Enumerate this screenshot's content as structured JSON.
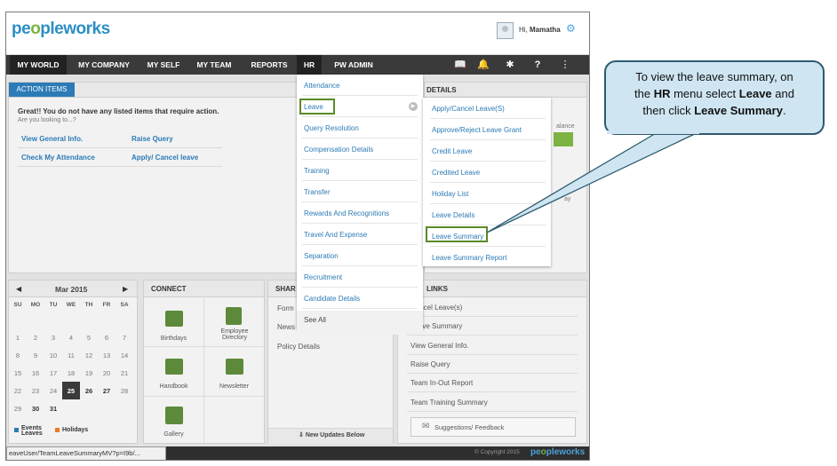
{
  "brand": {
    "logo_a": "pe",
    "logo_o1": "o",
    "logo_b": "pleworks",
    "logo_c": "w",
    "logo_o2": "o",
    "logo_d": "rks"
  },
  "user": {
    "greeting": "Hi,",
    "name": "Mamatha"
  },
  "nav": {
    "items": [
      "MY WORLD",
      "MY COMPANY",
      "MY SELF",
      "MY TEAM",
      "REPORTS",
      "HR",
      "PW ADMIN"
    ],
    "icons": [
      "book-icon",
      "bell-icon",
      "tools-icon",
      "help-icon",
      "menu-icon"
    ]
  },
  "action_items": {
    "tab": "ACTION ITEMS",
    "heading": "Great!! You do not have any listed items that require action.",
    "sub": "Are you looking to...?",
    "links": [
      "View General Info.",
      "Raise Query",
      "Check My Attendance",
      "Apply/ Cancel leave"
    ]
  },
  "details_panel": {
    "title": "DETAILS",
    "text1": "alance",
    "text2": "ay"
  },
  "calendar": {
    "month": "Mar 2015",
    "days": [
      "SU",
      "MO",
      "TU",
      "WE",
      "TH",
      "FR",
      "SA"
    ],
    "rows": [
      [
        "",
        "",
        "",
        "",
        "",
        "",
        ""
      ],
      [
        "1",
        "2",
        "3",
        "4",
        "5",
        "6",
        "7"
      ],
      [
        "8",
        "9",
        "10",
        "11",
        "12",
        "13",
        "14"
      ],
      [
        "15",
        "16",
        "17",
        "18",
        "19",
        "20",
        "21"
      ],
      [
        "22",
        "23",
        "24",
        "25",
        "26",
        "27",
        "28"
      ],
      [
        "29",
        "30",
        "31",
        "",
        "",
        "",
        ""
      ]
    ],
    "legend_events": "Events",
    "legend_leaves": "Leaves",
    "legend_holidays": "Holidays"
  },
  "connect": {
    "title": "CONNECT",
    "items": [
      "Birthdays",
      "Employee Directory",
      "Handbook",
      "Newsletter",
      "Gallery"
    ]
  },
  "share": {
    "title": "SHAR",
    "items": [
      "Form",
      "News",
      "Policy Details"
    ],
    "footer": "New Updates Below"
  },
  "quick_links": {
    "title": "LINKS",
    "items": [
      "Cancel Leave(s)",
      "Leave Summary",
      "View General Info.",
      "Raise Query",
      "Team In-Out Report",
      "Team Training Summary"
    ],
    "suggest": "Suggestions/ Feedback"
  },
  "hr_menu": {
    "items": [
      "Attendance",
      "Leave",
      "Query Resolution",
      "Compensation Details",
      "Training",
      "Transfer",
      "Rewards And Recognitions",
      "Travel And Expense",
      "Separation",
      "Recruitment",
      "Candidate Details",
      "See All"
    ]
  },
  "leave_menu": {
    "items": [
      "Apply/Cancel Leave(S)",
      "Approve/Reject Leave Grant",
      "Credit Leave",
      "Credited Leave",
      "Holiday List",
      "Leave Details",
      "Leave Summary",
      "Leave Summary Report"
    ]
  },
  "status": {
    "url": "eaveUser/TeamLeaveSummaryMV?p=I9b/...",
    "copyright": "© Copyright 2015"
  },
  "callout": {
    "l1": "To view the leave summary, on",
    "l2a": "the ",
    "l2b": "HR",
    "l2c": " menu select ",
    "l2d": "Leave",
    "l2e": " and",
    "l3a": "then click ",
    "l3b": "Leave Summary",
    "l3c": "."
  },
  "colors": {
    "accent": "#2c7bb6",
    "highlight": "#5a8a28",
    "callout_fill": "#cfe6f2",
    "callout_border": "#2e5a6e"
  }
}
